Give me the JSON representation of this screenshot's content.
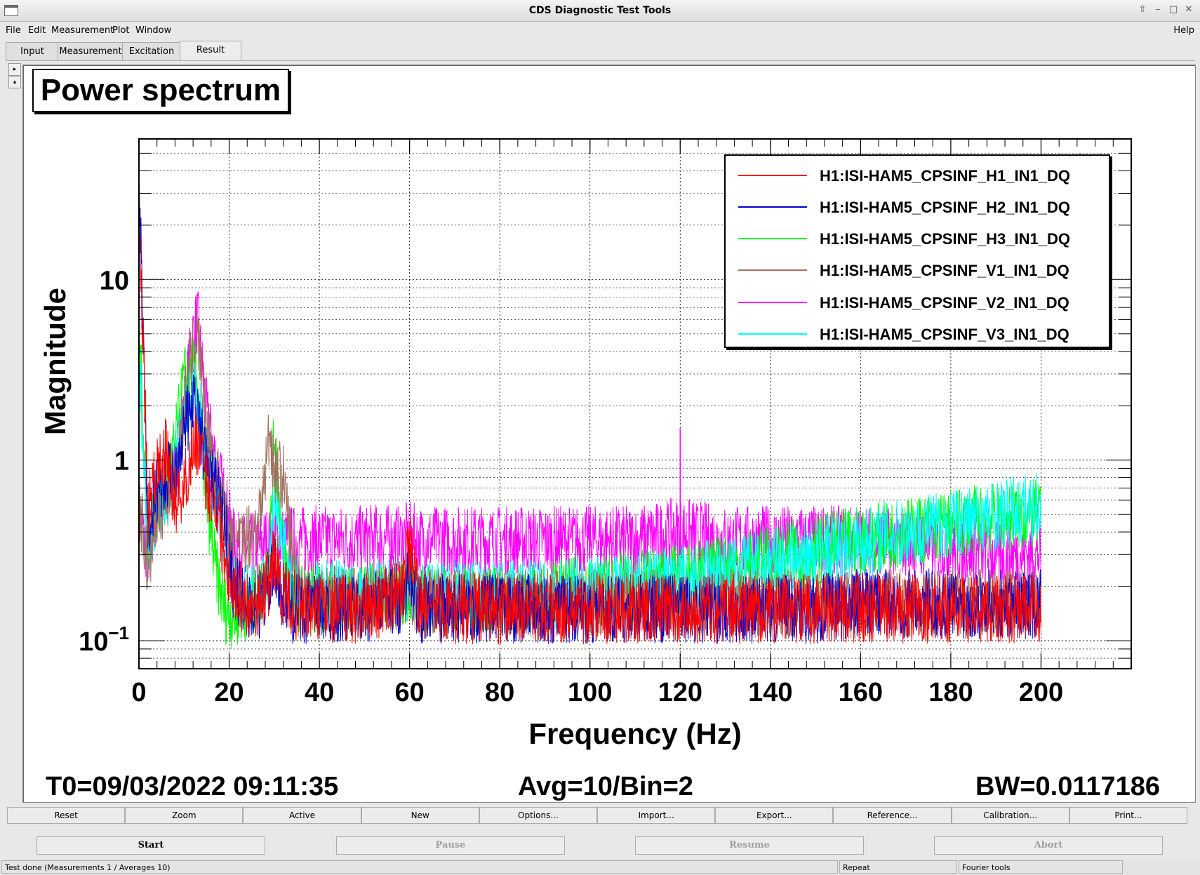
{
  "window": {
    "title": "CDS Diagnostic Test Tools"
  },
  "menu": {
    "file": "File",
    "edit": "Edit",
    "measurement": "Measurement",
    "plot": "Plot",
    "window": "Window",
    "help": "Help"
  },
  "tabs": [
    "Input",
    "Measurement",
    "Excitation",
    "Result"
  ],
  "plot_title": "Power spectrum",
  "info": {
    "t0": "T0=09/03/2022 09:11:35",
    "avg": "Avg=10/Bin=2",
    "bw": "BW=0.0117186"
  },
  "toolbar": [
    "Reset",
    "Zoom",
    "Active",
    "New",
    "Options...",
    "Import...",
    "Export...",
    "Reference...",
    "Calibration...",
    "Print..."
  ],
  "controls": {
    "start": "Start",
    "pause": "Pause",
    "resume": "Resume",
    "abort": "Abort"
  },
  "status": {
    "message": "Test done (Measurements 1 / Averages 10)",
    "repeat": "Repeat",
    "fourier": "Fourier tools"
  },
  "chart_data": {
    "type": "line",
    "title": "Power spectrum",
    "xlabel": "Frequency (Hz)",
    "ylabel": "Magnitude",
    "xlim": [
      0,
      220
    ],
    "ylim": [
      0.07,
      60
    ],
    "yscale": "log",
    "grid": true,
    "legend_position": "top-right",
    "x_ticks": [
      "0",
      "20",
      "40",
      "60",
      "80",
      "100",
      "120",
      "140",
      "160",
      "180",
      "200"
    ],
    "x_tick_values": [
      0,
      20,
      40,
      60,
      80,
      100,
      120,
      140,
      160,
      180,
      200
    ],
    "y_ticks": [
      "10",
      "1",
      "10−1"
    ],
    "y_tick_values": [
      10,
      1,
      0.1
    ],
    "x": [
      0,
      2,
      4,
      6,
      8,
      10,
      12,
      13,
      15,
      17,
      19,
      21,
      23,
      25,
      27,
      29,
      30,
      32,
      34,
      36,
      40,
      50,
      53,
      58,
      60,
      62,
      70,
      80,
      90,
      100,
      110,
      120,
      130,
      140,
      150,
      160,
      170,
      180,
      190,
      200
    ],
    "series": [
      {
        "name": "H1:ISI-HAM5_CPSINF_H1_IN1_DQ",
        "color": "#ff0000",
        "values": [
          30,
          0.5,
          0.9,
          1.1,
          0.6,
          0.7,
          1.2,
          1.3,
          0.75,
          0.6,
          0.3,
          0.2,
          0.17,
          0.16,
          0.17,
          0.22,
          0.3,
          0.18,
          0.16,
          0.15,
          0.15,
          0.15,
          0.16,
          0.18,
          0.35,
          0.16,
          0.15,
          0.15,
          0.15,
          0.15,
          0.15,
          0.15,
          0.15,
          0.15,
          0.15,
          0.15,
          0.15,
          0.15,
          0.15,
          0.15
        ]
      },
      {
        "name": "H1:ISI-HAM5_CPSINF_H2_IN1_DQ",
        "color": "#0000cc",
        "values": [
          40,
          0.4,
          0.7,
          0.8,
          0.9,
          1.5,
          2.0,
          1.8,
          0.9,
          0.7,
          0.45,
          0.2,
          0.17,
          0.15,
          0.16,
          0.2,
          0.25,
          0.18,
          0.15,
          0.15,
          0.15,
          0.15,
          0.16,
          0.17,
          0.25,
          0.15,
          0.15,
          0.15,
          0.15,
          0.15,
          0.15,
          0.15,
          0.15,
          0.15,
          0.15,
          0.16,
          0.16,
          0.16,
          0.16,
          0.16
        ]
      },
      {
        "name": "H1:ISI-HAM5_CPSINF_H3_IN1_DQ",
        "color": "#00ff00",
        "values": [
          6,
          0.35,
          0.6,
          0.7,
          1.2,
          2.8,
          3.2,
          2.5,
          0.6,
          0.25,
          0.15,
          0.14,
          0.15,
          0.16,
          0.18,
          0.3,
          1.5,
          0.3,
          0.18,
          0.17,
          0.17,
          0.17,
          0.18,
          0.18,
          0.2,
          0.17,
          0.17,
          0.17,
          0.18,
          0.19,
          0.2,
          0.22,
          0.25,
          0.28,
          0.32,
          0.36,
          0.4,
          0.44,
          0.48,
          0.5
        ]
      },
      {
        "name": "H1:ISI-HAM5_CPSINF_V1_IN1_DQ",
        "color": "#a07060",
        "values": [
          0.6,
          0.25,
          0.5,
          0.6,
          0.8,
          2.0,
          4.0,
          5.0,
          1.5,
          0.9,
          0.5,
          0.3,
          0.35,
          0.4,
          0.5,
          1.5,
          0.9,
          0.8,
          0.3,
          0.2,
          0.17,
          0.16,
          0.17,
          0.17,
          0.2,
          0.16,
          0.16,
          0.16,
          0.16,
          0.16,
          0.16,
          0.16,
          0.16,
          0.16,
          0.16,
          0.16,
          0.16,
          0.16,
          0.16,
          0.16
        ]
      },
      {
        "name": "H1:ISI-HAM5_CPSINF_V2_IN1_DQ",
        "color": "#ff00ff",
        "values": [
          0.5,
          0.3,
          0.6,
          0.7,
          0.8,
          2.0,
          5.0,
          6.0,
          1.8,
          1.0,
          0.6,
          0.35,
          0.32,
          0.33,
          0.34,
          0.36,
          0.36,
          0.36,
          0.36,
          0.36,
          0.36,
          0.36,
          0.37,
          0.36,
          0.38,
          0.36,
          0.36,
          0.36,
          0.36,
          0.36,
          0.36,
          0.4,
          0.36,
          0.36,
          0.36,
          0.36,
          0.35,
          0.33,
          0.3,
          0.3
        ]
      },
      {
        "name": "H1:ISI-HAM5_CPSINF_V3_IN1_DQ",
        "color": "#00ffff",
        "values": [
          4,
          0.3,
          0.55,
          0.7,
          0.9,
          1.8,
          2.5,
          2.2,
          1.1,
          0.7,
          0.4,
          0.2,
          0.18,
          0.17,
          0.18,
          0.25,
          0.6,
          0.4,
          0.2,
          0.18,
          0.18,
          0.18,
          0.18,
          0.18,
          0.2,
          0.18,
          0.18,
          0.18,
          0.18,
          0.19,
          0.2,
          0.22,
          0.24,
          0.27,
          0.3,
          0.35,
          0.4,
          0.45,
          0.5,
          0.55
        ]
      }
    ]
  }
}
